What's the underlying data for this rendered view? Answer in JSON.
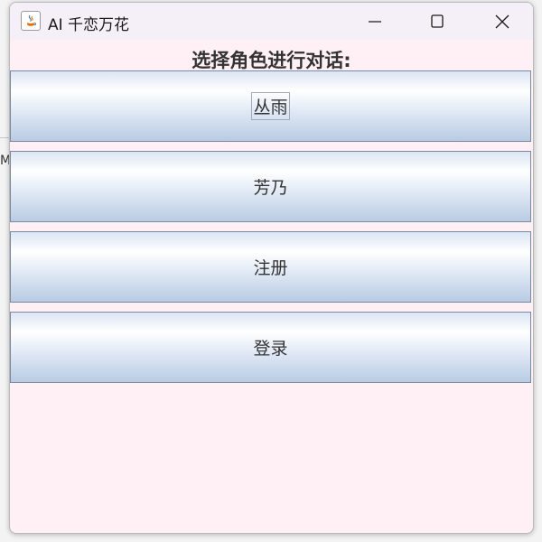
{
  "window": {
    "title": "AI 千恋万花",
    "icon": "java-icon"
  },
  "backdrop": {
    "text": "My"
  },
  "prompt": "选择角色进行对话:",
  "buttons": [
    {
      "label": "丛雨",
      "focused": true
    },
    {
      "label": "芳乃",
      "focused": false
    },
    {
      "label": "注册",
      "focused": false
    },
    {
      "label": "登录",
      "focused": false
    }
  ],
  "colors": {
    "window_background": "#fff0f5",
    "titlebar_background": "#f5f0f8",
    "button_gradient_top": "#ffffff",
    "button_gradient_bottom": "#b9cbe3",
    "text": "#333333"
  }
}
